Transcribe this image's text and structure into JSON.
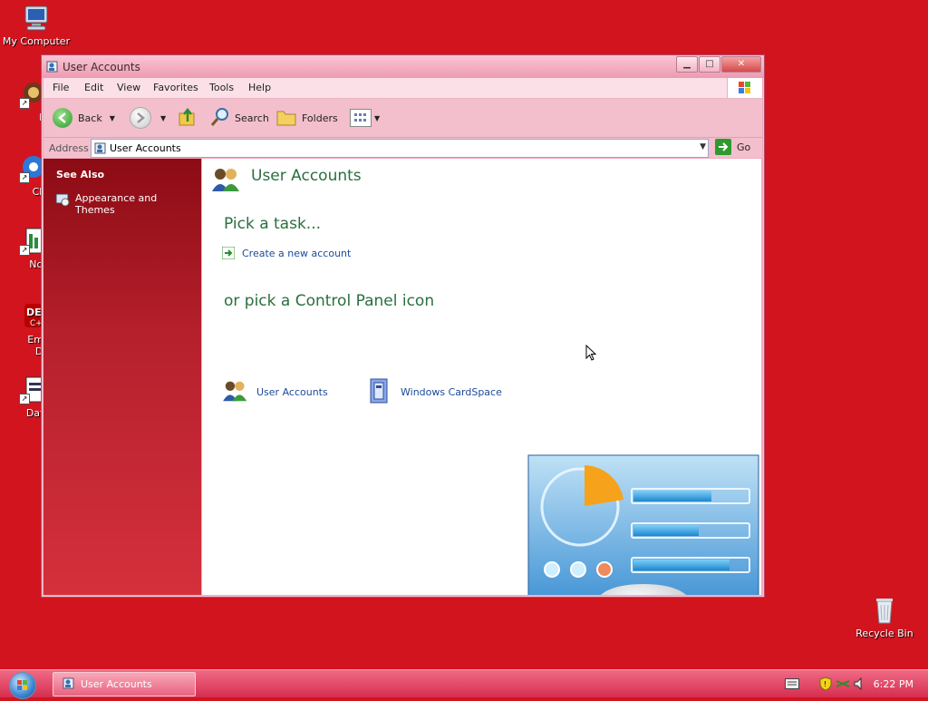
{
  "desktop": {
    "icons": [
      {
        "label": "My Computer"
      },
      {
        "label": "MyPa"
      },
      {
        "label": "Chrom"
      },
      {
        "label": "Notepa"
      },
      {
        "label": "Embarc",
        "label2": "Dev-C"
      },
      {
        "label": "DataWa"
      },
      {
        "label": "Recycle Bin"
      }
    ]
  },
  "window": {
    "title": "User Accounts",
    "controls": {
      "minimize": "▁",
      "maximize": "□",
      "close": "✕"
    },
    "menu": [
      "File",
      "Edit",
      "View",
      "Favorites",
      "Tools",
      "Help"
    ],
    "toolbar": {
      "back": "Back",
      "search": "Search",
      "folders": "Folders"
    },
    "address": {
      "label": "Address",
      "value": "User Accounts",
      "go": "Go"
    },
    "sidebar": {
      "heading": "See Also",
      "links": [
        "Appearance and Themes"
      ]
    },
    "content": {
      "title": "User Accounts",
      "pick_task": "Pick a task...",
      "tasks": [
        "Create a new account"
      ],
      "pick_icon": "or pick a Control Panel icon",
      "icons": [
        "User Accounts",
        "Windows CardSpace"
      ]
    }
  },
  "taskbar": {
    "items": [
      "User Accounts"
    ],
    "clock": "6:22 PM"
  },
  "colors": {
    "desktop": "#d2141e",
    "accent_green": "#2a6f3e",
    "link_blue": "#1b4a99"
  }
}
